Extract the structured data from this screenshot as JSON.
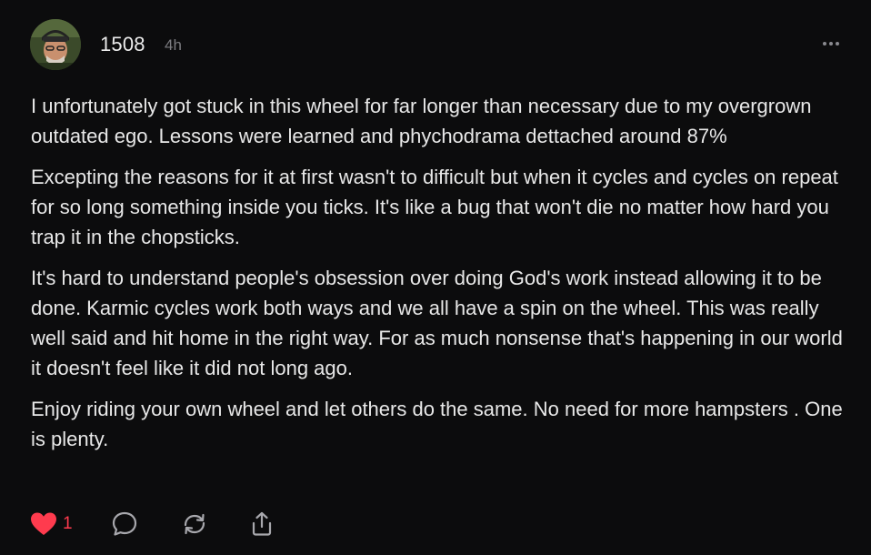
{
  "comment": {
    "author": "1508",
    "time": "4h",
    "paragraphs": [
      "I unfortunately got stuck in this wheel for far longer than necessary due to my overgrown outdated ego. Lessons were learned and phychodrama dettached around 87%",
      "Excepting the reasons for it at first wasn't to difficult but when it cycles and cycles on repeat for so long something inside you ticks. It's like a bug that won't die no matter how hard you trap it in the chopsticks.",
      "It's hard to understand people's obsession over doing God's work instead allowing it to be done. Karmic cycles work both ways and we all have a spin on the wheel. This was really well said and hit home in the right way. For as much nonsense that's happening in our world it doesn't feel like it did not long ago.",
      "Enjoy riding your own wheel and let others do the same. No need for more hampsters . One is plenty."
    ],
    "likes": "1",
    "liked": true
  },
  "icons": {
    "more": "more-horizontal-icon",
    "like": "heart-icon",
    "reply": "comment-bubble-icon",
    "repost": "repost-icon",
    "share": "share-icon"
  },
  "colors": {
    "background": "#0c0c0d",
    "text": "#e8e8e8",
    "muted": "#7c7c80",
    "like": "#ff3b4e",
    "icon": "#a8a8ad"
  }
}
